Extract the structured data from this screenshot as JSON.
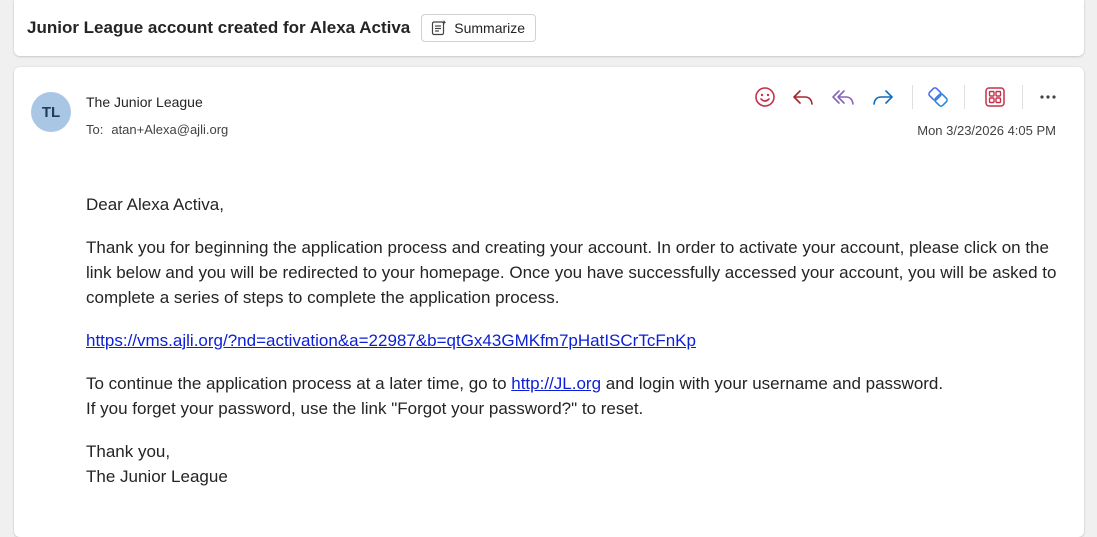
{
  "subject": {
    "title": "Junior League account created for Alexa Activa",
    "summarize_label": "Summarize"
  },
  "message": {
    "avatar_initials": "TL",
    "sender": "The Junior League",
    "to_label": "To:",
    "to_address": "atan+Alexa@ajli.org",
    "date": "Mon 3/23/2026 4:05 PM",
    "toolbar": {
      "icons": [
        "emoji-icon",
        "reply-icon",
        "reply-all-icon",
        "forward-icon",
        "loop-icon",
        "apps-icon",
        "more-icon"
      ],
      "colors": {
        "emoji": "#c4314b",
        "reply": "#a4262c",
        "reply_all": "#8764b8",
        "forward": "#0f6cbd",
        "loop": "#4f6bed",
        "apps": "#c4314b",
        "more": "#424242"
      }
    },
    "body": {
      "greeting": "Dear Alexa Activa,",
      "paragraph1": "Thank you for beginning the application process and creating your account. In order to activate your account, please click on the link below and you will be redirected to your homepage. Once you have successfully accessed your account, you will be asked to complete a series of steps to complete the application process.",
      "activation_link": "https://vms.ajli.org/?nd=activation&a=22987&b=qtGx43GMKfm7pHatISCrTcFnKp",
      "paragraph2_before": "To continue the application process at a later time, go to ",
      "paragraph2_link": "http://JL.org",
      "paragraph2_after": " and login with your username and password.",
      "paragraph2_line2": "If you forget your password, use the link \"Forgot your password?\" to reset.",
      "closing": "Thank you,",
      "signature": "The Junior League"
    }
  }
}
